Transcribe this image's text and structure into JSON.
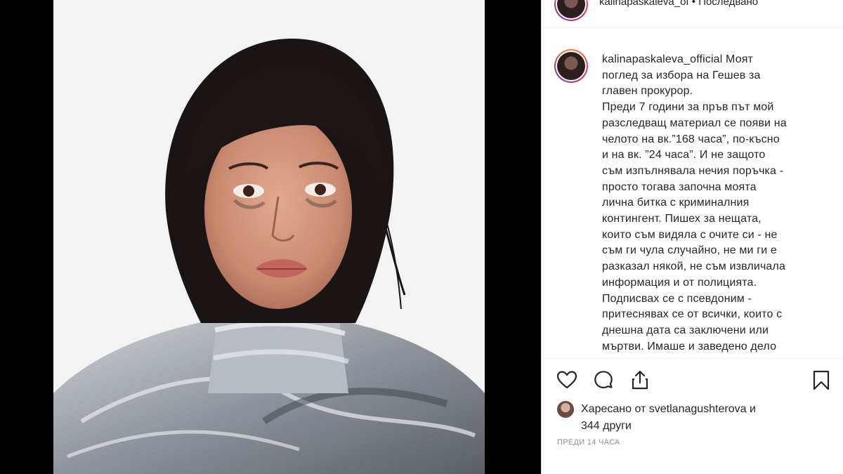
{
  "header": {
    "username": "kalinapaskaleva_of",
    "separator": " • ",
    "follow": "Последвано"
  },
  "post": {
    "username": "kalinapaskaleva_official",
    "caption_lines": [
      "Моят",
      "поглед за избора на Гешев за",
      "главен прокурор.",
      "Преди 7 години за пръв път мой",
      "разследващ материал се появи на",
      "челото на вк.”168 часа”, по-късно",
      "и на вк. ”24 часа”. И не защото",
      "съм изпълнявала нечия поръчка -",
      "просто тогава започна моята",
      "лична битка с криминалния",
      "контингент. Пишех за нещата,",
      "които съм видяла с очите си - не",
      "съм ги чула случайно, не ми ги е",
      "разказал някой, не съм извличала",
      "информация и от полицията.",
      "Подписвах се с псевдоним -",
      "притеснявах се от всички, които с",
      "днешна дата са заключени или",
      "мъртви. Имаше и заведено дело"
    ]
  },
  "actions": {
    "like_icon": "heart-outline",
    "comment_icon": "speech-bubble",
    "share_icon": "share-upload",
    "bookmark_icon": "bookmark-outline"
  },
  "likes": {
    "prefix": "Харесано от ",
    "user": "svetlanagushterova",
    "suffix": " и",
    "others": "344 други"
  },
  "timestamp": "ПРЕДИ 14 ЧАСА"
}
